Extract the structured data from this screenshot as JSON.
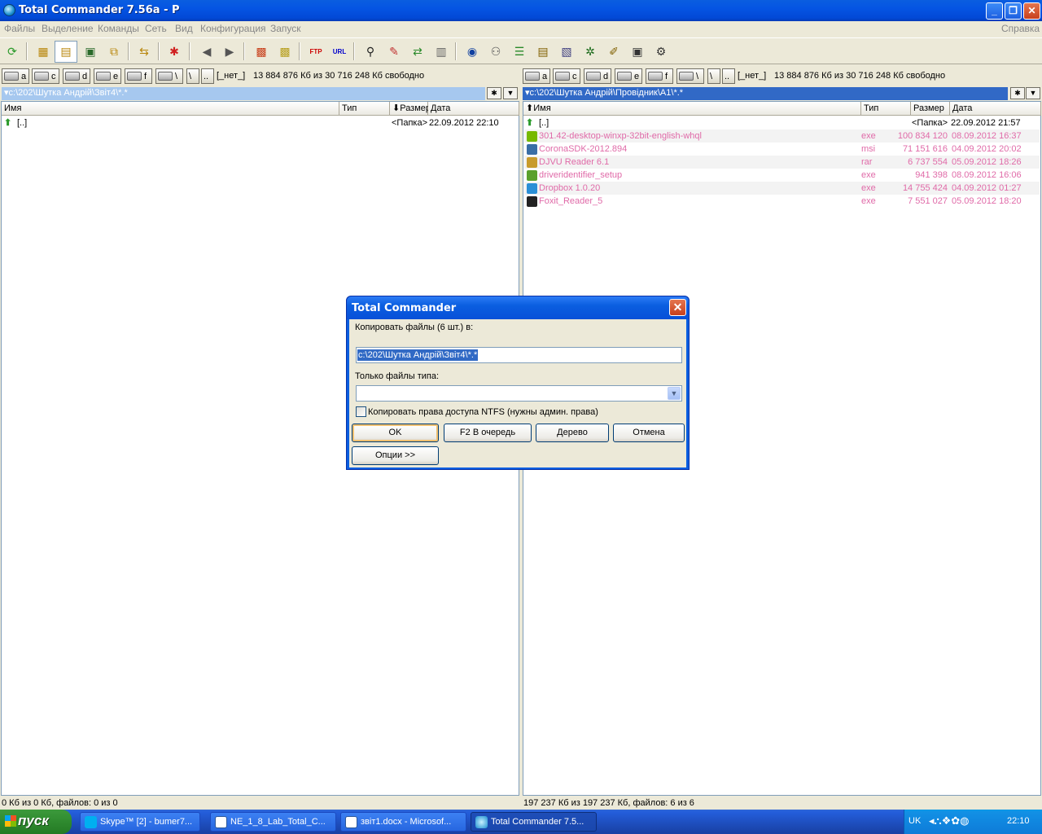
{
  "window": {
    "title": "Total Commander 7.56a - P"
  },
  "menu": [
    "Файлы",
    "Выделение",
    "Команды",
    "Сеть",
    "Вид",
    "Конфигурация",
    "Запуск",
    "Справка"
  ],
  "drives": [
    "a",
    "c",
    "d",
    "e",
    "f",
    "\\",
    "\\",
    ".."
  ],
  "left": {
    "free_label": "[_нет_]",
    "free_text": "13 884 876 Кб из 30 716 248 Кб свободно",
    "path": "c:\\202\\Шутка Андрій\\Звіт4\\*.*",
    "columns": {
      "name": "Имя",
      "type": "Тип",
      "size": "Размер",
      "date": "Дата"
    },
    "up_row": {
      "name": "[..]",
      "size": "<Папка>",
      "date": "22.09.2012 22:10"
    },
    "status": "0 Кб из 0 Кб, файлов: 0 из 0"
  },
  "right": {
    "free_label": "[_нет_]",
    "free_text": "13 884 876 Кб из 30 716 248 Кб свободно",
    "path": "c:\\202\\Шутка Андрій\\Провідник\\А1\\*.*",
    "columns": {
      "name": "Имя",
      "type": "Тип",
      "size": "Размер",
      "date": "Дата"
    },
    "up_row": {
      "name": "[..]",
      "size": "<Папка>",
      "date": "22.09.2012 21:57"
    },
    "files": [
      {
        "name": "301.42-desktop-winxp-32bit-english-whql",
        "type": "exe",
        "size": "100 834 120",
        "date": "08.09.2012 16:37",
        "icon": "nvidia-icon",
        "color": "#76b900"
      },
      {
        "name": "CoronaSDK-2012.894",
        "type": "msi",
        "size": "71 151 616",
        "date": "04.09.2012 20:02",
        "icon": "installer-icon",
        "color": "#3a6ea5"
      },
      {
        "name": "DJVU Reader 6.1",
        "type": "rar",
        "size": "6 737 554",
        "date": "05.09.2012 18:26",
        "icon": "archive-icon",
        "color": "#c89b2c"
      },
      {
        "name": "driveridentifier_setup",
        "type": "exe",
        "size": "941 398",
        "date": "08.09.2012 16:06",
        "icon": "setup-icon",
        "color": "#5aa02c"
      },
      {
        "name": "Dropbox 1.0.20",
        "type": "exe",
        "size": "14 755 424",
        "date": "04.09.2012 01:27",
        "icon": "dropbox-icon",
        "color": "#2a8fd6"
      },
      {
        "name": "Foxit_Reader_5",
        "type": "exe",
        "size": "7 551 027",
        "date": "05.09.2012 18:20",
        "icon": "7z-icon",
        "color": "#222222"
      }
    ],
    "status": "197 237 Кб из 197 237 Кб, файлов: 6 из 6"
  },
  "dialog": {
    "title": "Total Commander",
    "prompt": "Копировать файлы (6 шт.) в:",
    "target": "c:\\202\\Шутка Андрій\\Звіт4\\*.*",
    "filter_label": "Только файлы типа:",
    "filter_value": "",
    "ntfs_label": "Копировать права доступа NTFS (нужны админ. права)",
    "ntfs_checked": false,
    "buttons": {
      "ok": "OK",
      "queue": "F2 В очередь",
      "tree": "Дерево",
      "cancel": "Отмена",
      "options": "Опции >>"
    }
  },
  "taskbar": {
    "start": "пуск",
    "tasks": [
      "Skype™ [2] - bumer7...",
      "NE_1_8_Lab_Total_C...",
      "звіт1.docx - Microsof...",
      "Total Commander 7.5..."
    ],
    "lang": "UK",
    "clock": "22:10"
  }
}
